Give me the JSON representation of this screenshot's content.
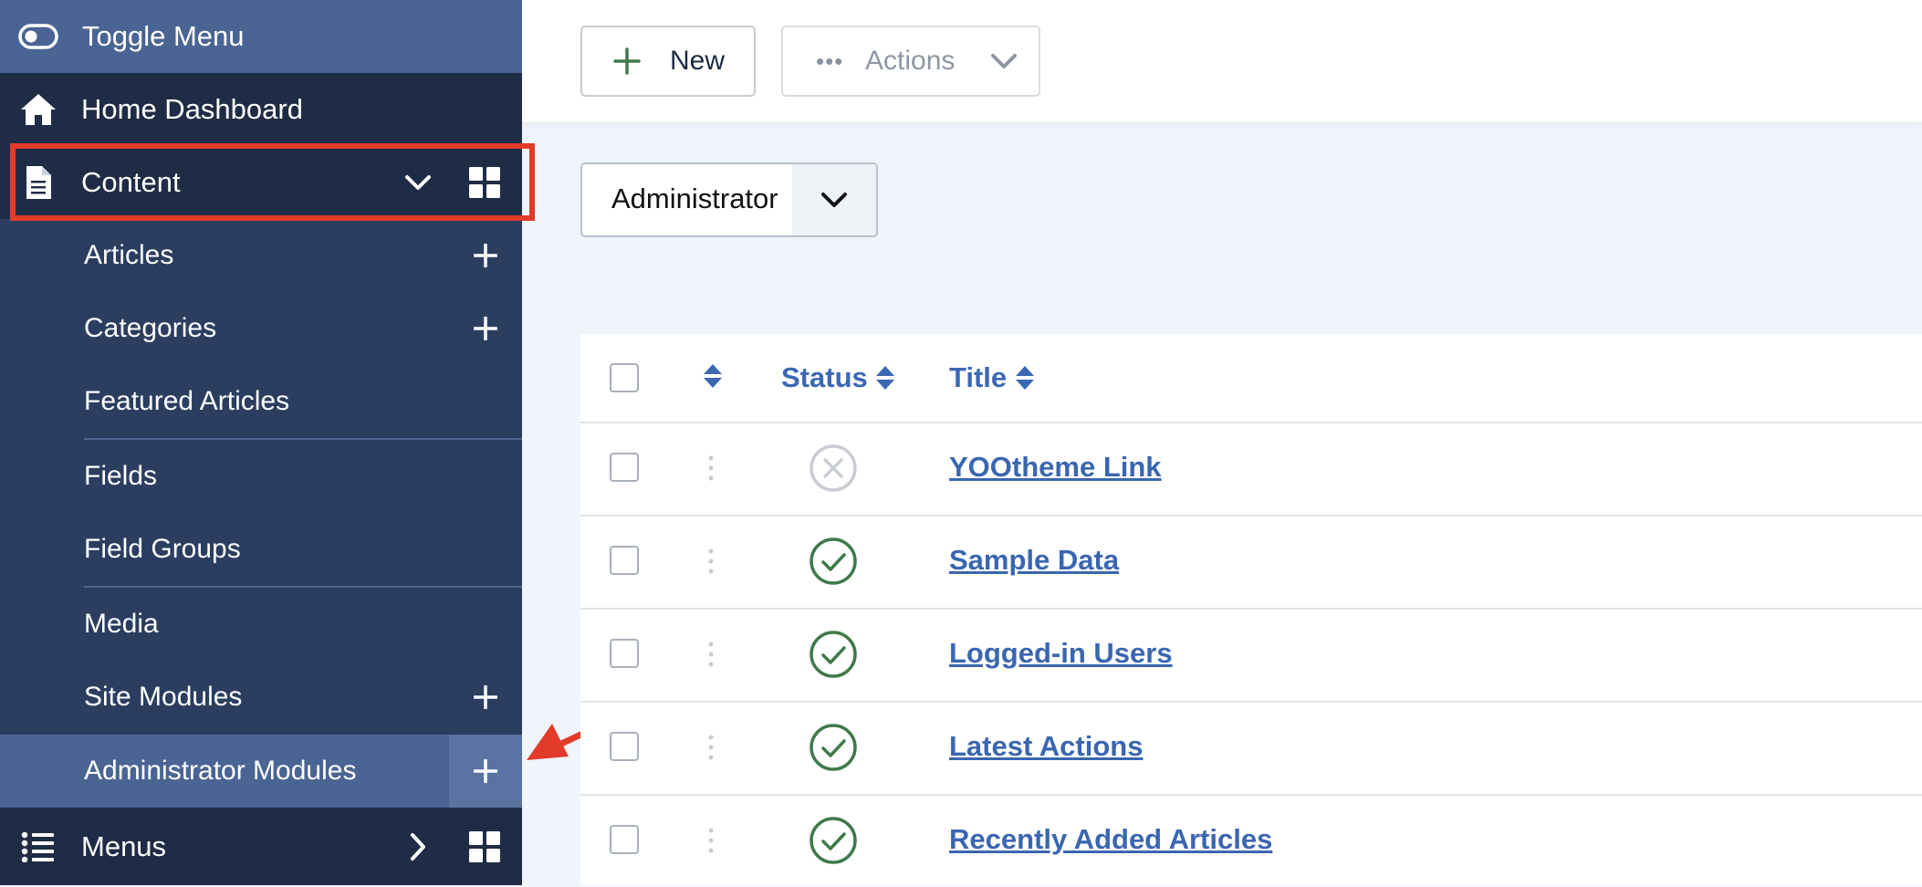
{
  "sidebar": {
    "toggle_label": "Toggle Menu",
    "home_label": "Home Dashboard",
    "content_label": "Content",
    "items": [
      {
        "label": "Articles"
      },
      {
        "label": "Categories"
      },
      {
        "label": "Featured Articles"
      },
      {
        "label": "Fields"
      },
      {
        "label": "Field Groups"
      },
      {
        "label": "Media"
      },
      {
        "label": "Site Modules"
      },
      {
        "label": "Administrator Modules"
      }
    ],
    "menus_label": "Menus"
  },
  "toolbar": {
    "new_label": "New",
    "actions_label": "Actions"
  },
  "filter": {
    "selected": "Administrator"
  },
  "table": {
    "columns": {
      "status": "Status",
      "title": "Title"
    },
    "rows": [
      {
        "title": "YOOtheme Link",
        "status": "unpublished"
      },
      {
        "title": "Sample Data",
        "status": "published"
      },
      {
        "title": "Logged-in Users",
        "status": "published"
      },
      {
        "title": "Latest Actions",
        "status": "published"
      },
      {
        "title": "Recently Added Articles",
        "status": "published"
      }
    ]
  },
  "colors": {
    "sidebar_bg": "#2b3e60",
    "sidebar_active": "#4a6494",
    "link_blue": "#3a66b0",
    "published_green": "#3f7a4a",
    "highlight_red": "#e33b2a"
  }
}
